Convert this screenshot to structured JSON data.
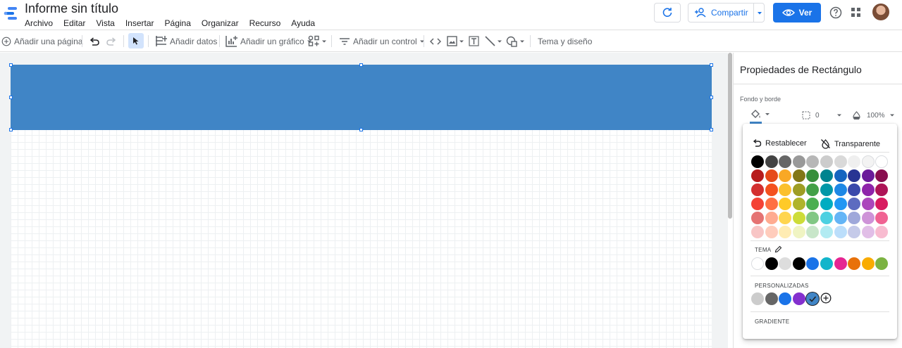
{
  "app": {
    "doc_title": "Informe sin título",
    "menu": [
      "Archivo",
      "Editar",
      "Vista",
      "Insertar",
      "Página",
      "Organizar",
      "Recurso",
      "Ayuda"
    ],
    "share_label": "Compartir",
    "view_label": "Ver"
  },
  "toolbar": {
    "add_page": "Añadir una página",
    "add_data": "Añadir datos",
    "add_chart": "Añadir un gráfico",
    "add_control": "Añadir un control",
    "theme": "Tema y diseño"
  },
  "panel": {
    "title": "Propiedades de Rectángulo",
    "section_label": "Fondo y borde",
    "border_width": "0",
    "opacity": "100%"
  },
  "picker": {
    "reset": "Restablecer",
    "transparent": "Transparente",
    "theme_label": "TEMA",
    "custom_label": "PERSONALIZADAS",
    "gradient_label": "GRADIENTE",
    "palette": [
      [
        "#000000",
        "#434343",
        "#666666",
        "#999999",
        "#b7b7b7",
        "#cccccc",
        "#d9d9d9",
        "#efefef",
        "#f3f3f3",
        "#ffffff"
      ],
      [
        "#b71c1c",
        "#e64a19",
        "#f9a825",
        "#827717",
        "#388e3c",
        "#00838f",
        "#1565c0",
        "#283593",
        "#6a1b9a",
        "#880e4f"
      ],
      [
        "#d32f2f",
        "#f4511e",
        "#fbc02d",
        "#9e9d24",
        "#43a047",
        "#0097a7",
        "#1e88e5",
        "#3949ab",
        "#8e24aa",
        "#ad1457"
      ],
      [
        "#f44336",
        "#ff7043",
        "#ffca28",
        "#afb42b",
        "#4caf50",
        "#00acc1",
        "#2196f3",
        "#5c6bc0",
        "#ab47bc",
        "#d81b60"
      ],
      [
        "#e57373",
        "#ffab91",
        "#ffd54f",
        "#cddc39",
        "#81c784",
        "#4dd0e1",
        "#64b5f6",
        "#9fa8da",
        "#ce93d8",
        "#f06292"
      ],
      [
        "#f8c5c5",
        "#ffccbc",
        "#ffecb3",
        "#f0f4c3",
        "#c8e6c9",
        "#b2ebf2",
        "#bbdefb",
        "#c5cae9",
        "#e1bee7",
        "#f8bbd0"
      ]
    ],
    "theme_colors": [
      "#ffffff",
      "#000000",
      "#dddddd",
      "#000000",
      "#1a73e8",
      "#12b5cb",
      "#e52592",
      "#e8710a",
      "#f9ab00",
      "#7cb342"
    ],
    "custom_colors": [
      "#cccccc",
      "#666666",
      "#1a73e8",
      "#8430ce",
      "#4085c6"
    ],
    "selected_custom_index": 4,
    "shape_fill": "#4085c6"
  }
}
